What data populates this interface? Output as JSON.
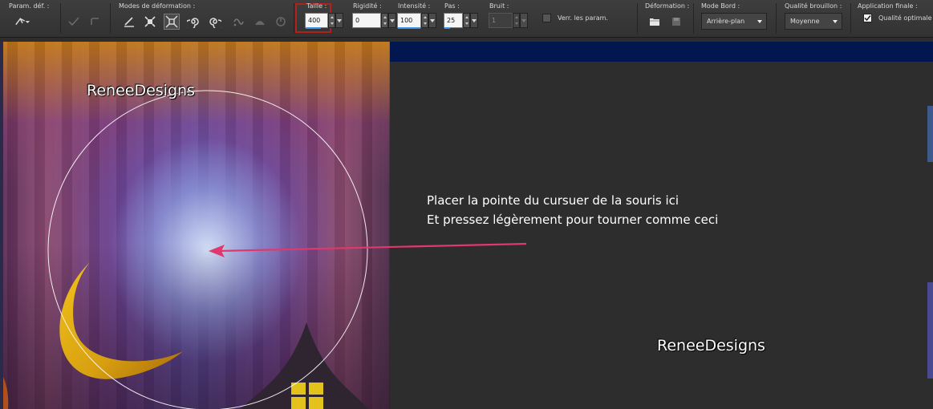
{
  "toolbar": {
    "param_label": "Param. déf. :",
    "modes_label": "Modes de déformation :",
    "size": {
      "label": "Taille :",
      "value": "400",
      "fill": 0.72
    },
    "rigidity": {
      "label": "Rigidité :",
      "value": "0",
      "fill": 0
    },
    "intensity": {
      "label": "Intensité :",
      "value": "100",
      "fill": 1.0
    },
    "step": {
      "label": "Pas :",
      "value": "25",
      "fill": 0.3
    },
    "noise": {
      "label": "Bruit :",
      "value": "1"
    },
    "lock_params_label": "Verr. les param.",
    "deformation_label": "Déformation :",
    "edge_mode": {
      "label": "Mode Bord :",
      "value": "Arrière-plan"
    },
    "draft_quality": {
      "label": "Qualité brouillon :",
      "value": "Moyenne"
    },
    "final_app": {
      "label": "Application finale :",
      "checkbox_label": "Qualité optimale"
    }
  },
  "canvas": {
    "watermark": "ReneeDesigns"
  },
  "instruction": {
    "line1": "Placer la pointe du cursuer de la souris ici",
    "line2": "Et pressez légèrement pour tourner comme ceci",
    "watermark": "ReneeDesigns"
  },
  "colors": {
    "arrow": "#e0386e",
    "highlight_box": "#b2201c",
    "navy_strip": "#021650",
    "slider_fill": "#3a8fe8"
  },
  "icons": {
    "preset": "warp-preset-icon",
    "apply": "checkmark-icon",
    "reset": "undo-icon",
    "modes": [
      "push-icon",
      "expand-icon",
      "contract-icon",
      "twirl-right-icon",
      "twirl-left-icon",
      "noise-icon",
      "iron-icon",
      "unwarp-icon"
    ],
    "deformation": [
      "open-folder-icon",
      "save-icon"
    ]
  }
}
